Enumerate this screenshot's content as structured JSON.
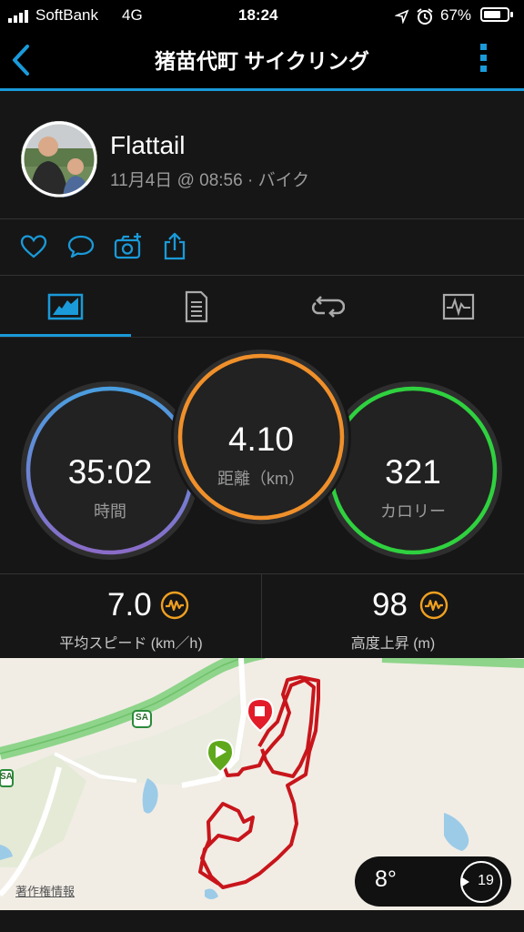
{
  "status_bar": {
    "carrier": "SoftBank",
    "network": "4G",
    "time": "18:24",
    "battery": "67%"
  },
  "nav": {
    "title": "猪苗代町 サイクリング"
  },
  "profile": {
    "name": "Flattail",
    "meta": "11月4日 @ 08:56 · バイク"
  },
  "rings": {
    "time_value": "35:02",
    "time_label": "時間",
    "distance_value": "4.10",
    "distance_label": "距離（km）",
    "calories_value": "321",
    "calories_label": "カロリー"
  },
  "stats": {
    "speed_value": "7.0",
    "speed_label": "平均スピード (km／h)",
    "elevation_value": "98",
    "elevation_label": "高度上昇 (m)"
  },
  "map": {
    "credit": "著作権情報",
    "road_badge": "SA",
    "road_badge_left": "SA",
    "temperature": "8°",
    "wind": "19"
  },
  "colors": {
    "accent": "#1a9ad9",
    "ring_time": "#5b8fd8",
    "ring_distance": "#f0902a",
    "ring_calories": "#2fd13f",
    "route": "#c8151b",
    "stat_icon": "#f0a020"
  }
}
